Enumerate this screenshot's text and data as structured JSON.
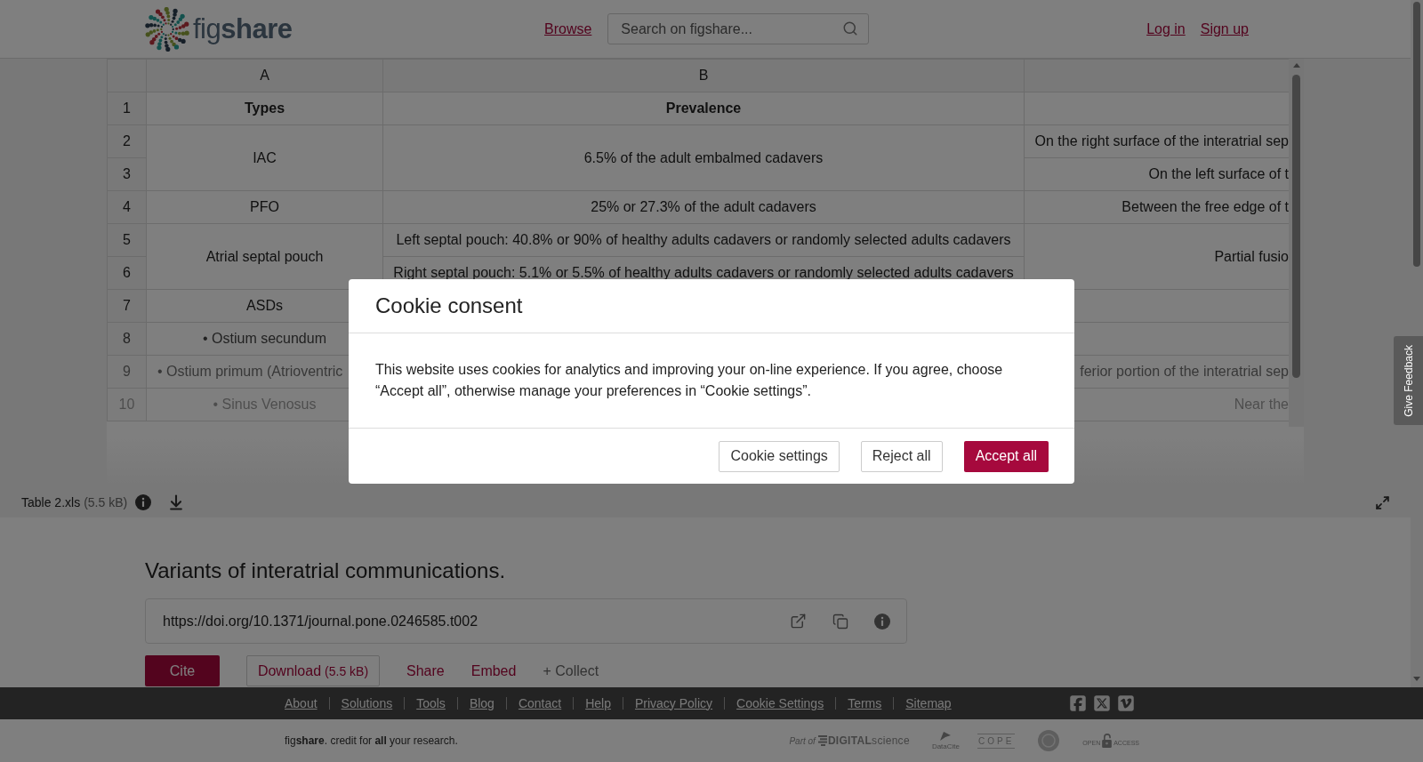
{
  "header": {
    "logo": "fig**share**",
    "nav_link": "Browse",
    "search": {
      "placeholder": "Search on figshare..."
    },
    "auth_links": [
      "Log in",
      "Sign up"
    ]
  },
  "sheet": {
    "columns": [
      "A",
      "B"
    ],
    "rows": [
      {
        "number": "1",
        "kind": "header",
        "cells": {
          "a": {
            "text": "Types"
          },
          "b": {
            "text": "Prevalence"
          }
        }
      },
      {
        "number": "2",
        "kind": "data",
        "cells": {
          "a": {
            "text": "IAC",
            "rowspan": 2
          },
          "b": {
            "text": "6.5% of the adult embalmed cadavers",
            "rowspan": 2
          },
          "c": {
            "text": "On the right surface of the interatrial sep"
          }
        }
      },
      {
        "number": "3",
        "kind": "data",
        "cells": {
          "c": {
            "text": "On the left surface of t"
          }
        }
      },
      {
        "number": "4",
        "kind": "data",
        "cells": {
          "a": {
            "text": "PFO"
          },
          "b": {
            "text": "25% or 27.3% of the adult cadavers"
          },
          "c": {
            "text": "Between the free edge of t"
          }
        }
      },
      {
        "number": "5",
        "kind": "data",
        "cells": {
          "a": {
            "text": "Atrial septal pouch",
            "rowspan": 2
          },
          "b": {
            "text": "Left septal pouch: 40.8% or 90% of healthy adults cadavers or randomly selected adults cadavers"
          },
          "c": {
            "text": "Partial fusio",
            "rowspan": 2
          }
        }
      },
      {
        "number": "6",
        "kind": "data",
        "cells": {
          "b": {
            "text": "Right septal pouch: 5.1% or 5.5% of healthy adults cadavers or randomly selected adults cadavers"
          }
        }
      },
      {
        "number": "7",
        "kind": "data",
        "cells": {
          "a": {
            "text": "ASDs"
          }
        }
      },
      {
        "number": "8",
        "kind": "data",
        "cells": {
          "a": {
            "text": "• Ostium secundum"
          }
        }
      },
      {
        "number": "9",
        "kind": "data",
        "cells": {
          "a": {
            "text": "• Ostium primum (Atrioventric"
          },
          "c": {
            "text": "ferior portion of the interatrial sep"
          }
        }
      },
      {
        "number": "10",
        "kind": "data",
        "cells": {
          "a": {
            "text": "• Sinus Venosus"
          },
          "c": {
            "text": "Near the"
          }
        }
      }
    ]
  },
  "file": {
    "name": "Table 2.xls",
    "size": "(5.5 kB)"
  },
  "item": {
    "title": "Variants of interatrial communications.",
    "doi": "https://doi.org/10.1371/journal.pone.0246585.t002",
    "actions": [
      {
        "kind": "primary",
        "label": "Cite"
      },
      {
        "kind": "outline",
        "label": "Download",
        "size": "(5.5 kB)"
      },
      {
        "kind": "link",
        "label": "Share"
      },
      {
        "kind": "link",
        "label": "Embed"
      },
      {
        "kind": "muted",
        "label": "+ Collect"
      }
    ]
  },
  "footer": {
    "links": [
      "About",
      "Solutions",
      "Tools",
      "Blog",
      "Contact",
      "Help",
      "Privacy Policy",
      "Cookie Settings",
      "Terms",
      "Sitemap"
    ],
    "tagline": "fig**share**. credit for **all** your research.",
    "partner_logos": [
      {
        "kind": "digital",
        "prefix": "Part of",
        "name": "**DIGITAL**science"
      },
      {
        "kind": "stacked",
        "name": "DataCite"
      },
      {
        "kind": "spaced",
        "name": "COPE"
      },
      {
        "kind": "seal"
      },
      {
        "kind": "lock",
        "name": "OPEN",
        "suffix": "ACCESS"
      }
    ]
  },
  "feedback_tab": "Give Feedback",
  "cookie_dialog": {
    "title": "Cookie consent",
    "message": "This website uses cookies for analytics and improving your on-line experience. If you agree, choose “Accept all”, otherwise manage your preferences in “Cookie settings”.",
    "buttons": [
      {
        "kind": "outline",
        "label": "Cookie settings"
      },
      {
        "kind": "outline",
        "label": "Reject all"
      },
      {
        "kind": "primary",
        "label": "Accept all"
      }
    ]
  }
}
